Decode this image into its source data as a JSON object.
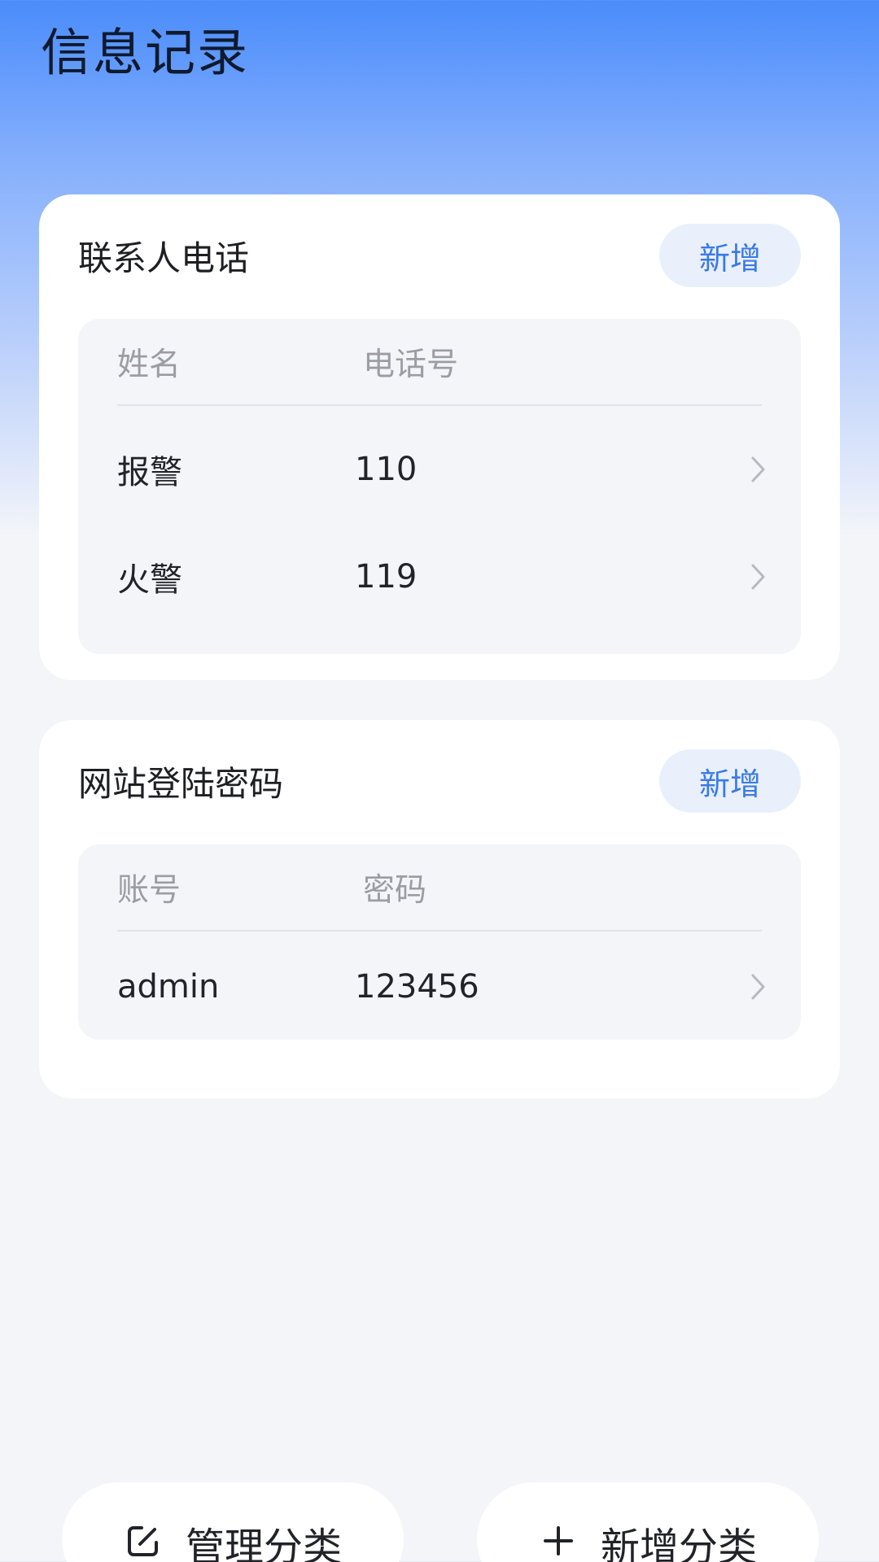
{
  "page": {
    "title": "信息记录"
  },
  "sections": [
    {
      "title": "联系人电话",
      "add_label": "新增",
      "columns": [
        "姓名",
        "电话号"
      ],
      "rows": [
        {
          "col1": "报警",
          "col2": "110"
        },
        {
          "col1": "火警",
          "col2": "119"
        }
      ]
    },
    {
      "title": "网站登陆密码",
      "add_label": "新增",
      "columns": [
        "账号",
        "密码"
      ],
      "rows": [
        {
          "col1": "admin",
          "col2": "123456"
        }
      ]
    }
  ],
  "bottom": {
    "manage_label": "管理分类",
    "manage_icon": "edit-icon",
    "add_label": "新增分类",
    "add_icon": "plus-icon"
  },
  "colors": {
    "accent": "#3a7ae6",
    "accent_bg": "#e9f0fc",
    "header_top": "#4a8cfb",
    "background": "#f3f5f9"
  }
}
